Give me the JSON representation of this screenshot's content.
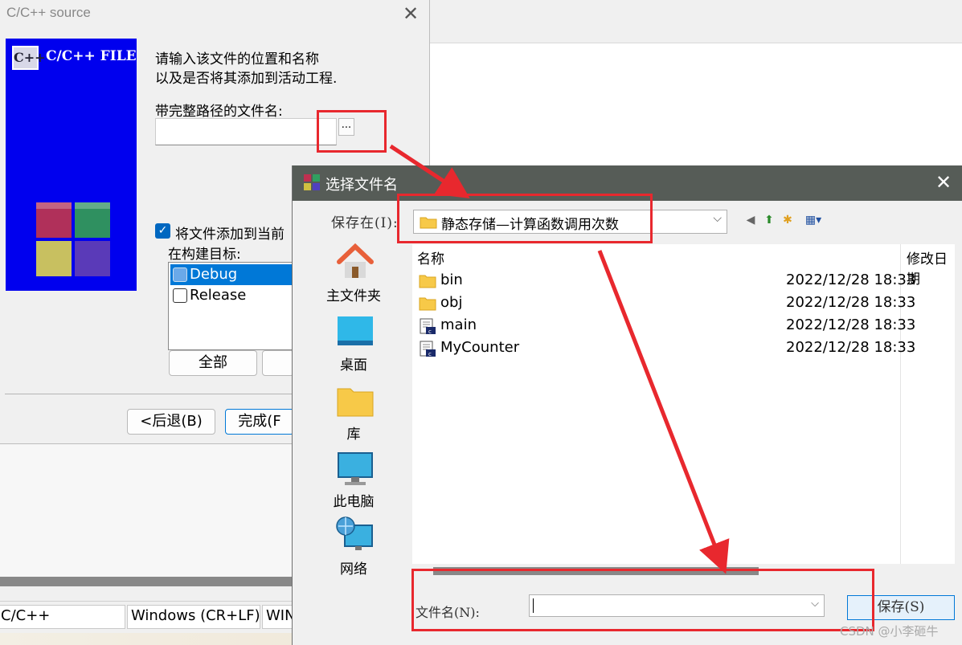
{
  "wizard": {
    "title": "C/C++ source",
    "banner_badge": "C++",
    "banner_title": "C/C++ FILE",
    "instruction_line1": "请输入该文件的位置和名称",
    "instruction_line2": "以及是否将其添加到活动工程.",
    "path_label": "带完整路径的文件名:",
    "browse_label": "...",
    "add_checkbox_label": "将文件添加到当前",
    "build_targets_label": "在构建目标:",
    "targets": [
      {
        "label": "Debug",
        "selected": true
      },
      {
        "label": "Release",
        "selected": false
      }
    ],
    "all_button": "全部",
    "back_button": "<后退(B)",
    "finish_button": "完成(F"
  },
  "status_bar": {
    "language": "C/C++",
    "line_ending": "Windows (CR+LF)",
    "encoding": "WIN"
  },
  "file_dialog": {
    "title": "选择文件名",
    "save_in_label": "保存在(I):",
    "save_in_value": "静态存储—计算函数调用次数",
    "places": [
      {
        "label": "主文件夹",
        "icon": "home-icon"
      },
      {
        "label": "桌面",
        "icon": "desktop-icon"
      },
      {
        "label": "库",
        "icon": "library-folder-icon"
      },
      {
        "label": "此电脑",
        "icon": "computer-icon"
      },
      {
        "label": "网络",
        "icon": "network-icon"
      }
    ],
    "columns": {
      "name": "名称",
      "modified": "修改日期"
    },
    "files": [
      {
        "name": "bin",
        "modified": "2022/12/28 18:33",
        "type": "folder"
      },
      {
        "name": "obj",
        "modified": "2022/12/28 18:33",
        "type": "folder"
      },
      {
        "name": "main",
        "modified": "2022/12/28 18:33",
        "type": "c-file"
      },
      {
        "name": "MyCounter",
        "modified": "2022/12/28 18:33",
        "type": "c-file"
      }
    ],
    "filename_label": "文件名(N):",
    "filename_value": "",
    "save_button": "保存(S)"
  },
  "watermark": "CSDN @小李砸牛",
  "colors": {
    "annotation_red": "#e8282e",
    "titlebar": "#565c57",
    "banner_blue": "#0000ee",
    "selection_blue": "#0078d7"
  }
}
